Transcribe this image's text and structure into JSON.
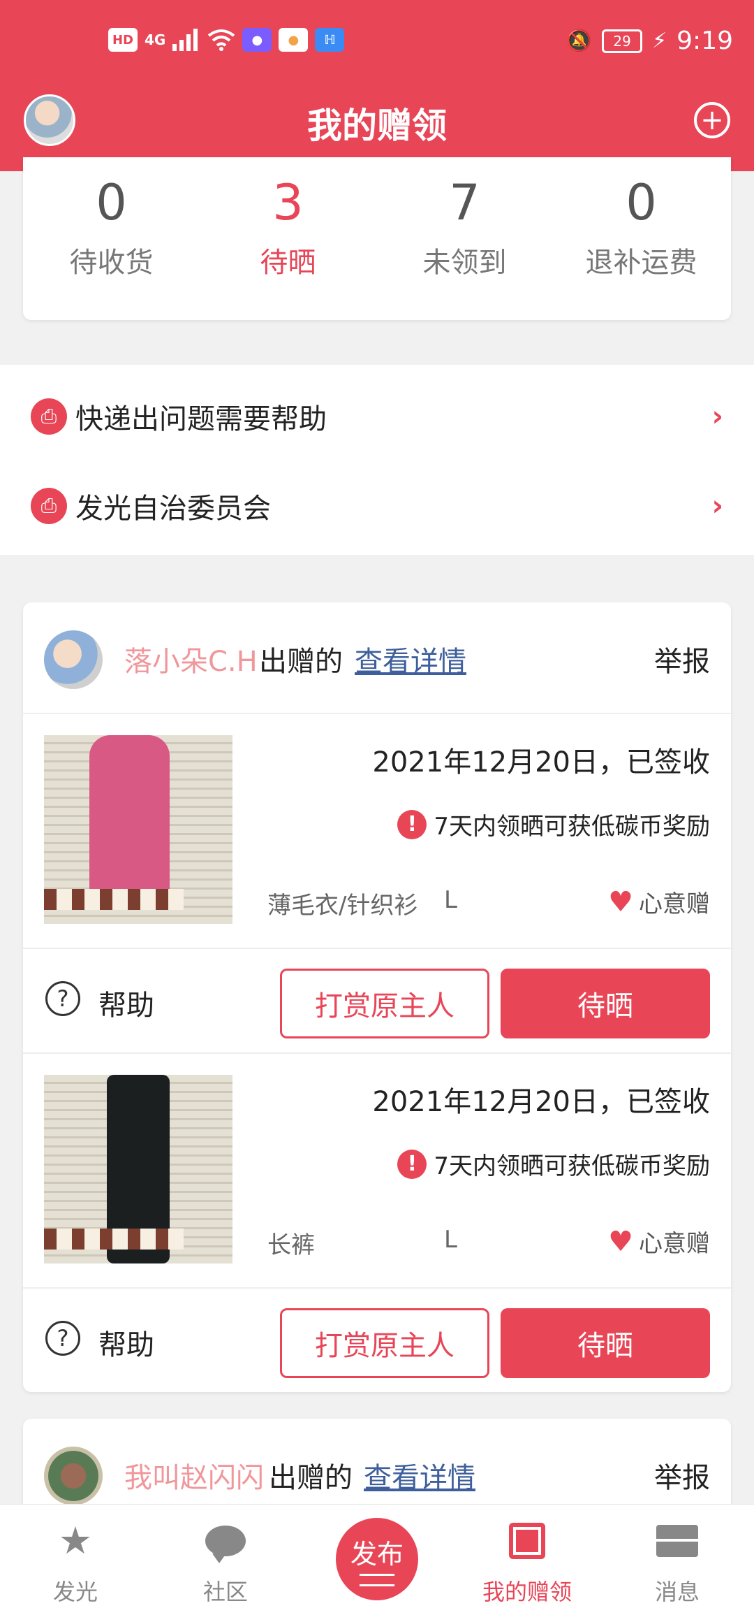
{
  "status_bar": {
    "left_icons": [
      "HD",
      "4G",
      "signal-icon",
      "wifi-icon",
      "app-icon-1",
      "app-icon-2",
      "app-icon-3"
    ],
    "battery": "29",
    "time": "9:19"
  },
  "header": {
    "title": "我的赠领",
    "add_icon": "plus-circle-icon"
  },
  "stats": [
    {
      "value": "0",
      "label": "待收货",
      "active": false
    },
    {
      "value": "3",
      "label": "待晒",
      "active": true
    },
    {
      "value": "7",
      "label": "未领到",
      "active": false
    },
    {
      "value": "0",
      "label": "退补运费",
      "active": false
    }
  ],
  "links": [
    {
      "label": "快递出问题需要帮助",
      "icon": "printer-icon"
    },
    {
      "label": "发光自治委员会",
      "icon": "printer-icon"
    }
  ],
  "gift_cards": [
    {
      "giver": "落小朵C.H",
      "gave_text": "出赠的",
      "detail_link": "查看详情",
      "report": "举报",
      "items": [
        {
          "date_status": "2021年12月20日，已签收",
          "reward": "7天内领晒可获低碳币奖励",
          "category": "薄毛衣/针织衫",
          "size": "L",
          "tag": "心意赠",
          "help": "帮助",
          "tip_button": "打赏原主人",
          "show_button": "待晒"
        },
        {
          "date_status": "2021年12月20日，已签收",
          "reward": "7天内领晒可获低碳币奖励",
          "category": "长裤",
          "size": "L",
          "tag": "心意赠",
          "help": "帮助",
          "tip_button": "打赏原主人",
          "show_button": "待晒"
        }
      ]
    },
    {
      "giver": "我叫赵闪闪",
      "gave_text": "出赠的",
      "detail_link": "查看详情",
      "report": "举报"
    }
  ],
  "bottom_nav": [
    {
      "label": "发光",
      "icon": "star-icon",
      "active": false
    },
    {
      "label": "社区",
      "icon": "chat-icon",
      "active": false
    },
    {
      "label": "发布",
      "icon": "publish-icon",
      "active": false
    },
    {
      "label": "我的赠领",
      "icon": "book-icon",
      "active": true
    },
    {
      "label": "消息",
      "icon": "mail-icon",
      "active": false
    }
  ],
  "colors": {
    "accent": "#e84557",
    "giver_name": "#f0979b",
    "link": "#3e5f9b"
  }
}
